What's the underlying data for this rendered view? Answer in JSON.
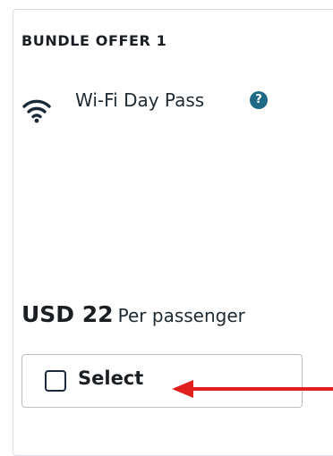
{
  "bundle": {
    "title": "BUNDLE OFFER 1",
    "feature": {
      "label": "Wi-Fi Day Pass",
      "icon": "wifi-icon",
      "help_icon": "help-icon",
      "help_symbol": "?"
    },
    "price": {
      "amount": "USD 22",
      "unit": "Per passenger"
    },
    "select": {
      "label": "Select",
      "checked": false
    }
  },
  "colors": {
    "help_icon_bg": "#1e6a87",
    "annotation_arrow": "#e0201c",
    "text": "#1b1f23"
  }
}
